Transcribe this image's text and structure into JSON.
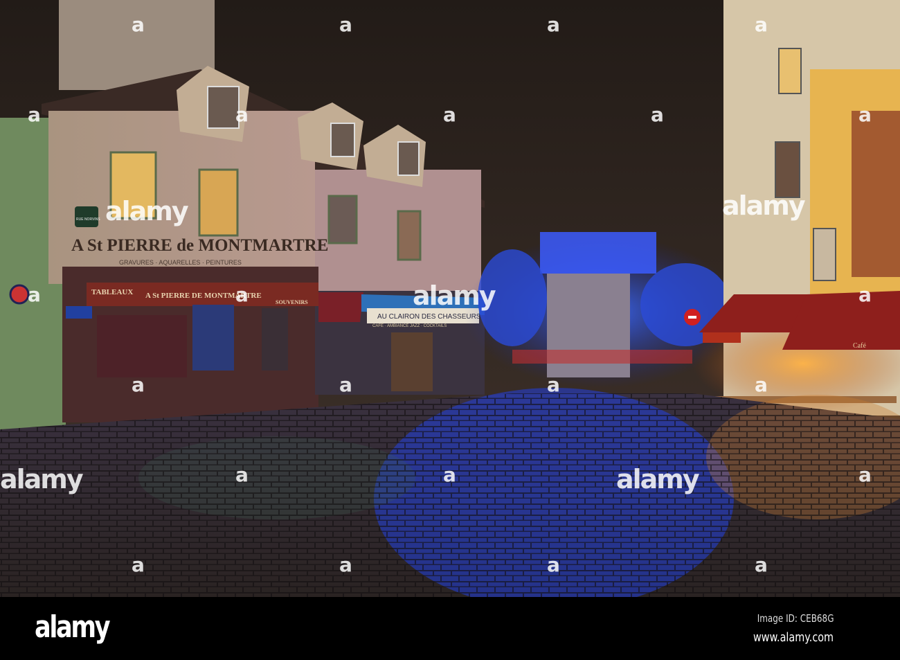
{
  "scene": {
    "facade_sign": "A St PIERRE de MONTMARTRE",
    "facade_subtitle": "GRAVURES · AQUARELLES · PEINTURES",
    "shop_sign_left": "TABLEAUX",
    "shop_sign_center": "A St PIERRE DE MONTMARTRE",
    "shop_sign_right": "SOUVENIRS",
    "street_sign": "RUE NORVINS",
    "cafe_sign": "AU CLAIRON DES CHASSEURS",
    "cafe_subsign": "CAFÉ · AMBIANCE JAZZ · COCKTAILS",
    "right_cafe_awning": "Café"
  },
  "watermark": {
    "text": "alamy",
    "letter": "a"
  },
  "footer": {
    "logo": "alamy",
    "image_id": "Image ID: CEB68G",
    "url": "www.alamy.com"
  },
  "colors": {
    "sky": "#2a221d",
    "facade": "#b79a86",
    "right_building": "#e7b450",
    "blue_lights": "#2d5cff",
    "awning_red": "#8e1f1c"
  }
}
